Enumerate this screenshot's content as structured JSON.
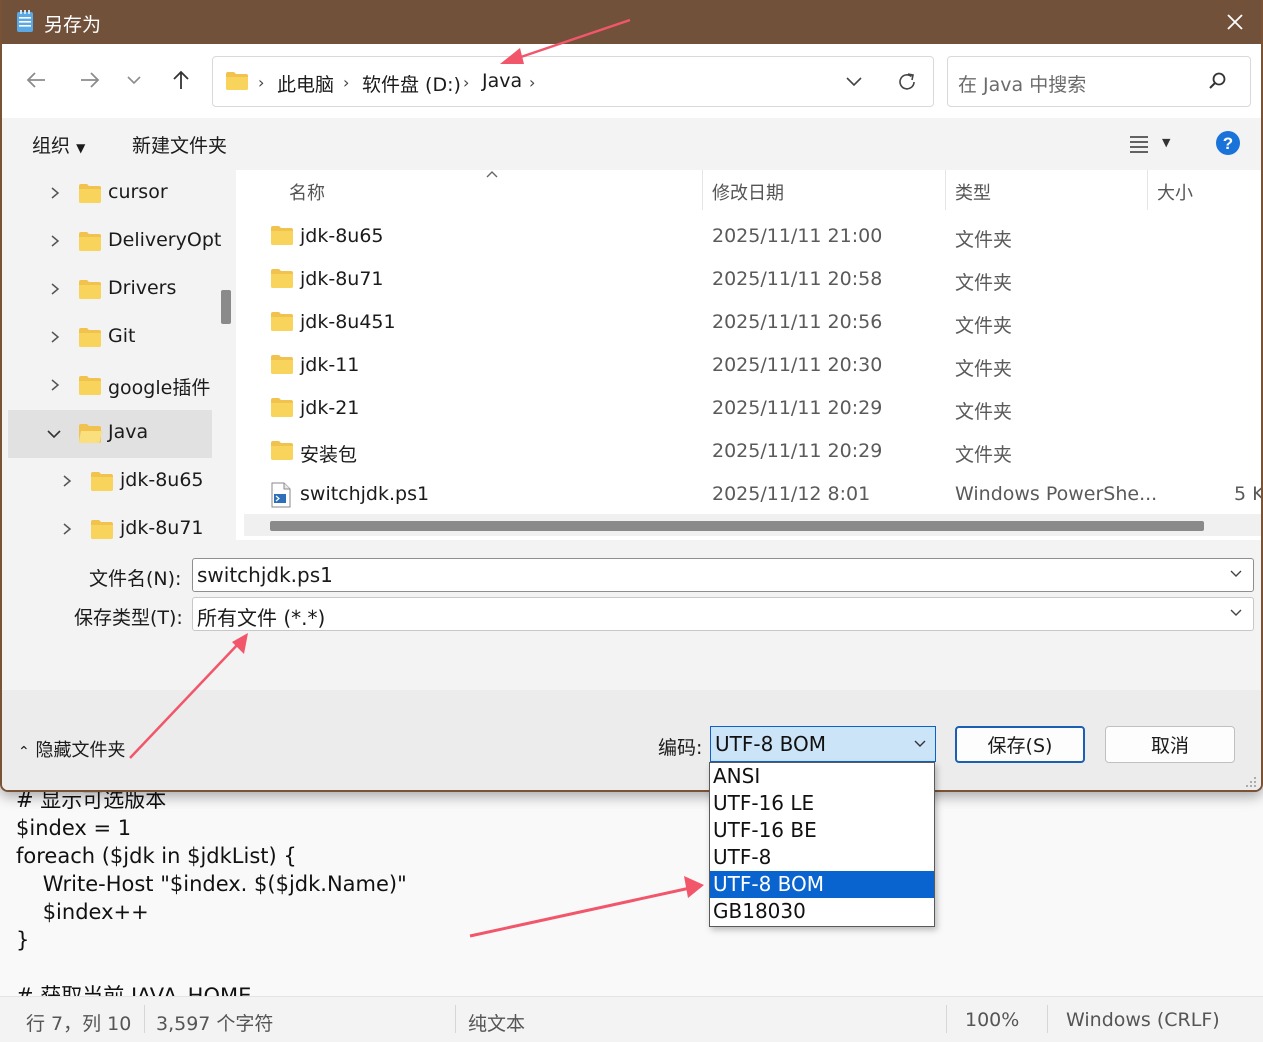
{
  "dialog": {
    "title": "另存为",
    "close_icon": "close-icon"
  },
  "nav": {
    "breadcrumbs": [
      "此电脑",
      "软件盘 (D:)",
      "Java"
    ],
    "search_placeholder": "在 Java 中搜索"
  },
  "commands": {
    "organize": "组织",
    "new_folder": "新建文件夹"
  },
  "tree": [
    {
      "label": "cursor",
      "expanded": false,
      "selected": false,
      "indent": 0
    },
    {
      "label": "DeliveryOpt",
      "expanded": false,
      "selected": false,
      "indent": 0
    },
    {
      "label": "Drivers",
      "expanded": false,
      "selected": false,
      "indent": 0
    },
    {
      "label": "Git",
      "expanded": false,
      "selected": false,
      "indent": 0
    },
    {
      "label": "google插件",
      "expanded": false,
      "selected": false,
      "indent": 0
    },
    {
      "label": "Java",
      "expanded": true,
      "selected": true,
      "indent": 0
    },
    {
      "label": "jdk-8u65",
      "expanded": false,
      "selected": false,
      "indent": 1
    },
    {
      "label": "jdk-8u71",
      "expanded": false,
      "selected": false,
      "indent": 1
    }
  ],
  "columns": {
    "name": "名称",
    "date": "修改日期",
    "type": "类型",
    "size": "大小"
  },
  "files": [
    {
      "name": "jdk-8u65",
      "date": "2025/11/11 21:00",
      "type": "文件夹",
      "size": "",
      "icon": "folder-icon"
    },
    {
      "name": "jdk-8u71",
      "date": "2025/11/11 20:58",
      "type": "文件夹",
      "size": "",
      "icon": "folder-icon"
    },
    {
      "name": "jdk-8u451",
      "date": "2025/11/11 20:56",
      "type": "文件夹",
      "size": "",
      "icon": "folder-icon"
    },
    {
      "name": "jdk-11",
      "date": "2025/11/11 20:30",
      "type": "文件夹",
      "size": "",
      "icon": "folder-icon"
    },
    {
      "name": "jdk-21",
      "date": "2025/11/11 20:29",
      "type": "文件夹",
      "size": "",
      "icon": "folder-icon"
    },
    {
      "name": "安装包",
      "date": "2025/11/11 20:29",
      "type": "文件夹",
      "size": "",
      "icon": "folder-icon"
    },
    {
      "name": "switchjdk.ps1",
      "date": "2025/11/12 8:01",
      "type": "Windows PowerShe...",
      "size": "5 K",
      "icon": "powershell-script-icon"
    }
  ],
  "form": {
    "filename_label": "文件名(N):",
    "filename_value": "switchjdk.ps1",
    "filetype_label": "保存类型(T):",
    "filetype_value": "所有文件  (*.*)"
  },
  "footer": {
    "hide_folders": "隐藏文件夹",
    "encoding_label": "编码:",
    "encoding_value": "UTF-8 BOM",
    "save_button": "保存(S)",
    "cancel_button": "取消"
  },
  "encoding_options": [
    {
      "label": "ANSI",
      "selected": false
    },
    {
      "label": "UTF-16 LE",
      "selected": false
    },
    {
      "label": "UTF-16 BE",
      "selected": false
    },
    {
      "label": "UTF-8",
      "selected": false
    },
    {
      "label": "UTF-8 BOM",
      "selected": true
    },
    {
      "label": "GB18030",
      "selected": false
    }
  ],
  "editor": {
    "lines": [
      "# 显示可选版本",
      "$index = 1",
      "foreach ($jdk in $jdkList) {",
      "    Write-Host \"$index. $($jdk.Name)\"",
      "    $index++",
      "}",
      "",
      "# 获取当前 JAVA_HOME"
    ]
  },
  "statusbar": {
    "position": "行 7，列 10",
    "chars": "3,597 个字符",
    "format": "纯文本",
    "zoom": "100%",
    "line_ending": "Windows (CRLF)"
  },
  "colors": {
    "titlebar": "#72513a",
    "accent": "#0a64d0",
    "folder": "#f2c24f",
    "annotation_arrow": "#f2566b"
  }
}
